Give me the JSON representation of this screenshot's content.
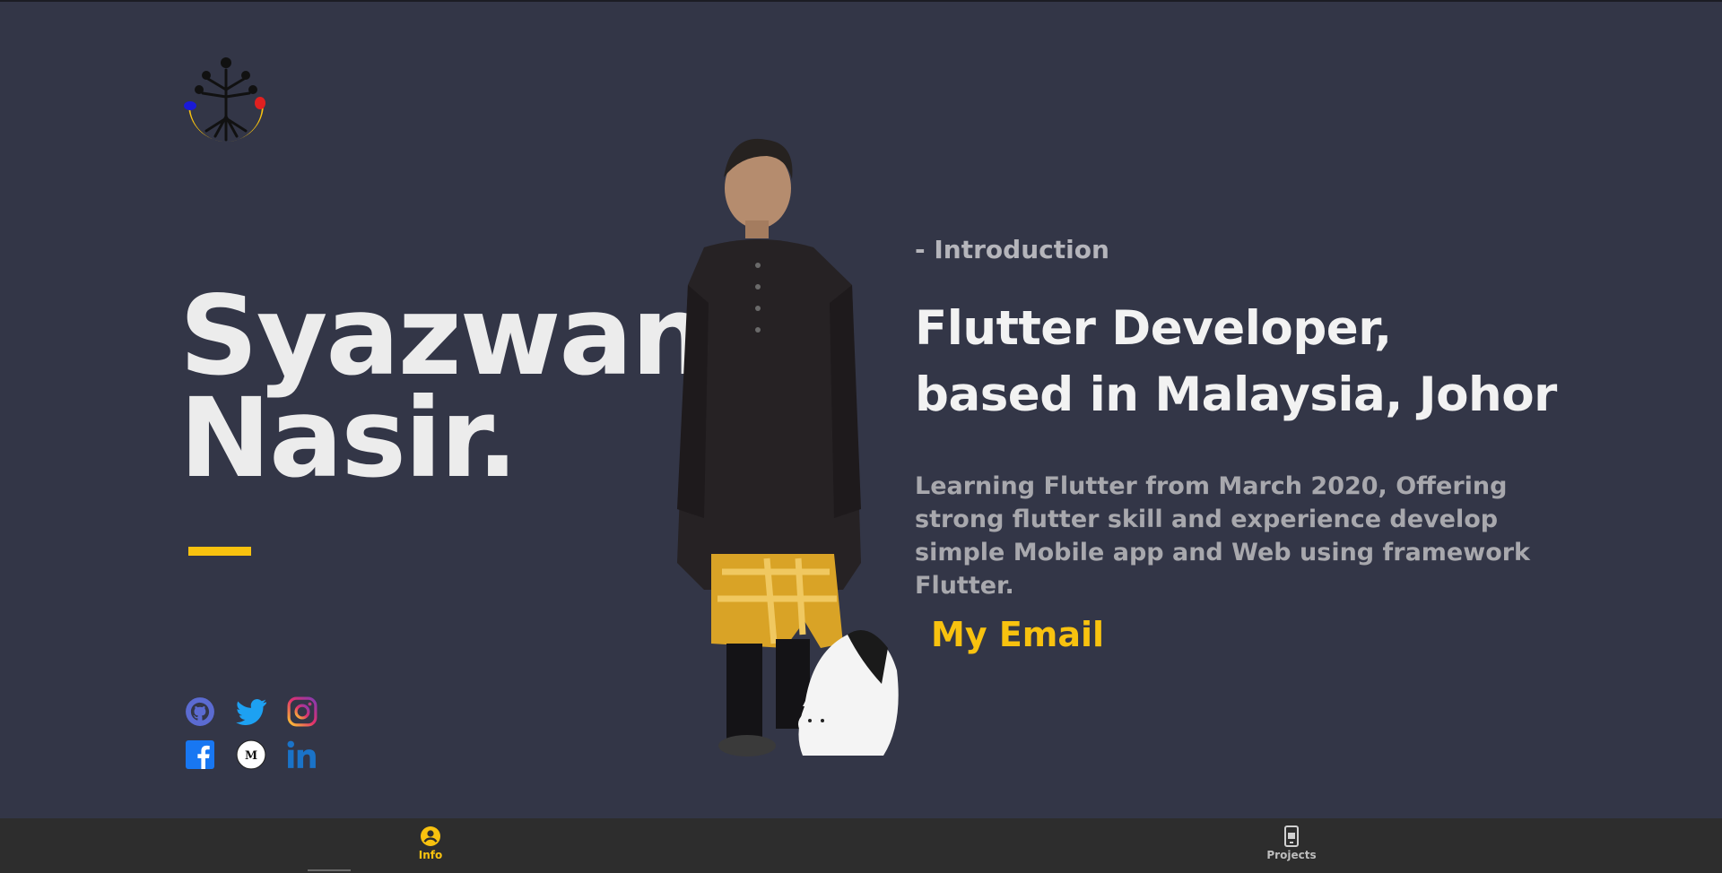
{
  "hero": {
    "name_line1": "Syazwan",
    "name_line2": "Nasir."
  },
  "intro": {
    "label": "- Introduction",
    "headline_line1": "Flutter Developer,",
    "headline_line2": "based in Malaysia, Johor",
    "description": "Learning Flutter from March 2020, Offering strong flutter skill and experience develop simple Mobile app and Web using framework Flutter.",
    "email_label": "My Email"
  },
  "socials": [
    "github-icon",
    "twitter-icon",
    "instagram-icon",
    "facebook-icon",
    "medium-icon",
    "linkedin-icon"
  ],
  "bottom_nav": {
    "items": [
      {
        "label": "Info",
        "icon": "account-circle-icon",
        "active": true
      },
      {
        "label": "Projects",
        "icon": "phone-app-icon",
        "active": false
      }
    ]
  },
  "colors": {
    "background": "#333647",
    "accent": "#f8c20f",
    "nav_background": "#2d2d2d",
    "nav_inactive": "#bdbdbd"
  }
}
